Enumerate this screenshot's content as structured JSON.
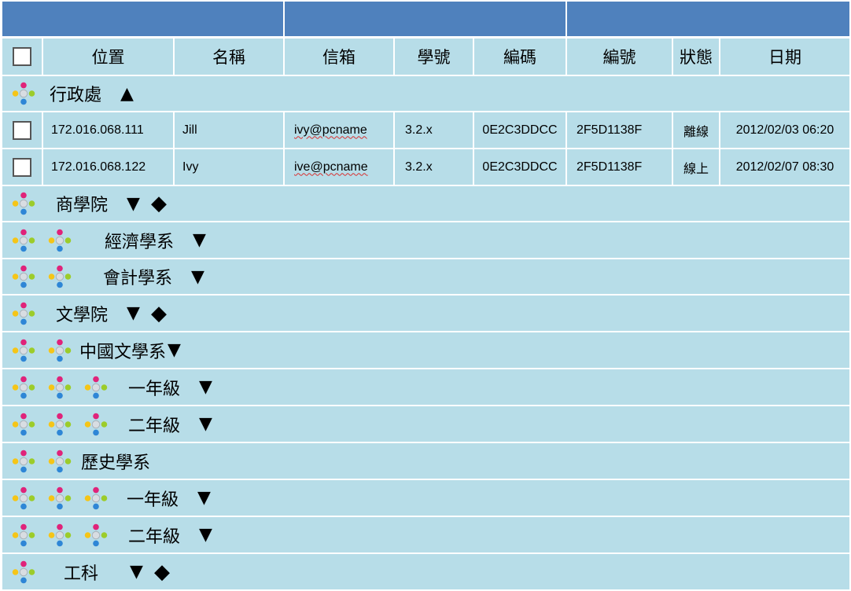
{
  "columns": {
    "checkbox": "",
    "location": "位置",
    "name": "名稱",
    "email": "信箱",
    "student_id": "學號",
    "code": "編碼",
    "number": "編號",
    "status": "狀態",
    "date": "日期"
  },
  "top_group": {
    "label": "行政處",
    "toggle": "▲"
  },
  "records": [
    {
      "location": "172.016.068.111",
      "name": "Jill",
      "email": "ivy@pcname",
      "student_id": "3.2.x",
      "code": "0E2C3DDCC",
      "number": "2F5D1138F",
      "status": "離線",
      "date": "2012/02/03 06:20"
    },
    {
      "location": "172.016.068.122",
      "name": "Ivy",
      "email": "ive@pcname",
      "student_id": "3.2.x",
      "code": "0E2C3DDCC",
      "number": "2F5D1138F",
      "status": "線上",
      "date": "2012/02/07 08:30"
    }
  ],
  "groups": [
    {
      "label": "商學院",
      "toggle": "▼",
      "marker": "◆"
    },
    {
      "label": "經濟學系",
      "toggle": "▼",
      "marker": ""
    },
    {
      "label": "會計學系",
      "toggle": "▼",
      "marker": ""
    },
    {
      "label": "文學院",
      "toggle": "▼",
      "marker": "◆"
    },
    {
      "label": "中國文學系",
      "toggle": "▼",
      "marker": ""
    },
    {
      "label": "一年級",
      "toggle": "▼",
      "marker": ""
    },
    {
      "label": "二年級",
      "toggle": "▼",
      "marker": ""
    },
    {
      "label": "歷史學系",
      "toggle": "",
      "marker": ""
    },
    {
      "label": "一年級",
      "toggle": "▼",
      "marker": ""
    },
    {
      "label": "二年級",
      "toggle": "▼",
      "marker": ""
    },
    {
      "label": "工科",
      "toggle": "▼",
      "marker": "◆"
    }
  ],
  "icons": {
    "group": "node-group-icon",
    "checkbox": "checkbox-icon"
  },
  "colors": {
    "header": "#4f81bd",
    "row": "#b7dde8",
    "separator": "#ffffff",
    "icon_pink": "#e0237a",
    "icon_yellow": "#f5c518",
    "icon_green": "#9ccc2a",
    "icon_blue": "#2e86d6",
    "icon_center": "#d8dde2"
  }
}
